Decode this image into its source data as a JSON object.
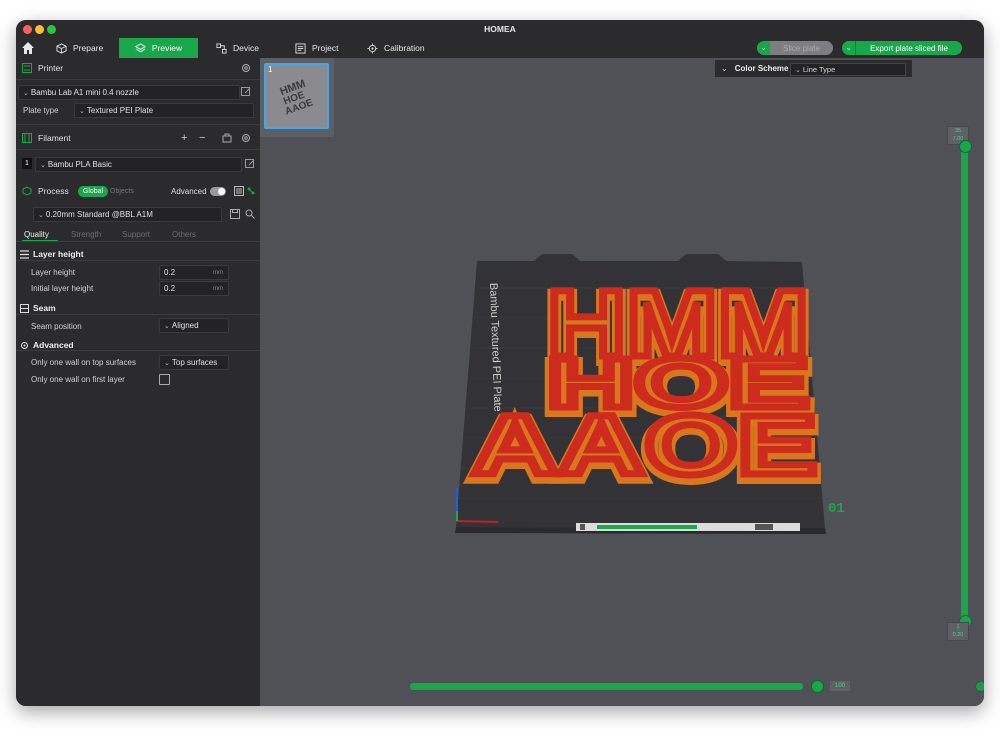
{
  "window": {
    "title": "HOMEA"
  },
  "nav": {
    "tabs": [
      {
        "label": "Prepare"
      },
      {
        "label": "Preview"
      },
      {
        "label": "Device"
      },
      {
        "label": "Project"
      },
      {
        "label": "Calibration"
      }
    ],
    "active_tab": "Preview",
    "slice_label": "Slice plate",
    "export_label": "Export plate sliced file"
  },
  "printer": {
    "heading": "Printer",
    "model": "Bambu Lab A1 mini 0.4 nozzle",
    "plate_type_label": "Plate type",
    "plate_type": "Textured PEI Plate"
  },
  "filament": {
    "heading": "Filament",
    "slot": "1",
    "name": "Bambu PLA Basic"
  },
  "process": {
    "heading": "Process",
    "toggle_global": "Global",
    "toggle_objects": "Objects",
    "advanced_label": "Advanced",
    "preset": "0.20mm Standard @BBL A1M",
    "tabs": [
      "Quality",
      "Strength",
      "Support",
      "Others"
    ]
  },
  "settings": {
    "layer_height_heading": "Layer height",
    "layer_height_label": "Layer height",
    "layer_height_value": "0.2",
    "initial_layer_height_label": "Initial layer height",
    "initial_layer_height_value": "0.2",
    "unit": "mm",
    "seam_heading": "Seam",
    "seam_position_label": "Seam position",
    "seam_position_value": "Aligned",
    "advanced_heading": "Advanced",
    "one_wall_top_label": "Only one wall on top surfaces",
    "one_wall_top_value": "Top surfaces",
    "one_wall_first_label": "Only one wall on first layer",
    "one_wall_first_checked": false
  },
  "preview": {
    "plate_number": "1",
    "color_scheme_label": "Color Scheme",
    "color_scheme_value": "Line Type",
    "bed_text": "Bambu Textured PEI Plate",
    "plate_index": "01",
    "model_letters": "HMM HOE AAOE",
    "model_color": "#cc2b1d",
    "model_side_color": "#d9771c"
  },
  "sliders": {
    "top_layer": "35",
    "top_height": "7.00",
    "bottom_layer": "1",
    "bottom_height": "0.20",
    "move_value": "100"
  },
  "colors": {
    "accent": "#18a84b"
  }
}
